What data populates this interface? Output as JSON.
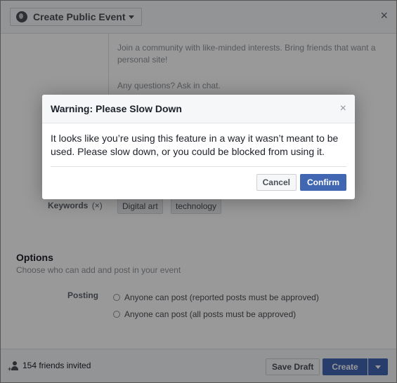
{
  "background_dialog": {
    "event_type_label": "Create Public Event",
    "close_glyph": "×",
    "description_lines": [
      "Join a community with like-minded interests. Bring friends that want a personal site!",
      "Any questions? Ask in chat."
    ],
    "keywords": {
      "label": "Keywords",
      "clear_glyph": "(×)",
      "tags": [
        "Digital art",
        "technology"
      ]
    },
    "options": {
      "title": "Options",
      "subtitle": "Choose who can add and post in your event",
      "posting_label": "Posting",
      "radio_options": [
        "Anyone can post (reported posts must be approved)",
        "Anyone can post (all posts must be approved)"
      ]
    },
    "footer": {
      "friends_invited": "154 friends invited",
      "save_draft_label": "Save Draft",
      "create_label": "Create"
    }
  },
  "modal": {
    "title": "Warning: Please Slow Down",
    "close_glyph": "×",
    "message": "It looks like you’re using this feature in a way it wasn’t meant to be used. Please slow down, or you could be blocked from using it.",
    "cancel_label": "Cancel",
    "confirm_label": "Confirm"
  },
  "colors": {
    "primary_button": "#4267b2",
    "overlay": "rgba(0,0,0,0.4)",
    "header_bg": "#f6f7f9"
  },
  "icons": {
    "event_type": "globe-icon",
    "dropdown": "chevron-down-icon",
    "friends": "add-person-icon"
  }
}
